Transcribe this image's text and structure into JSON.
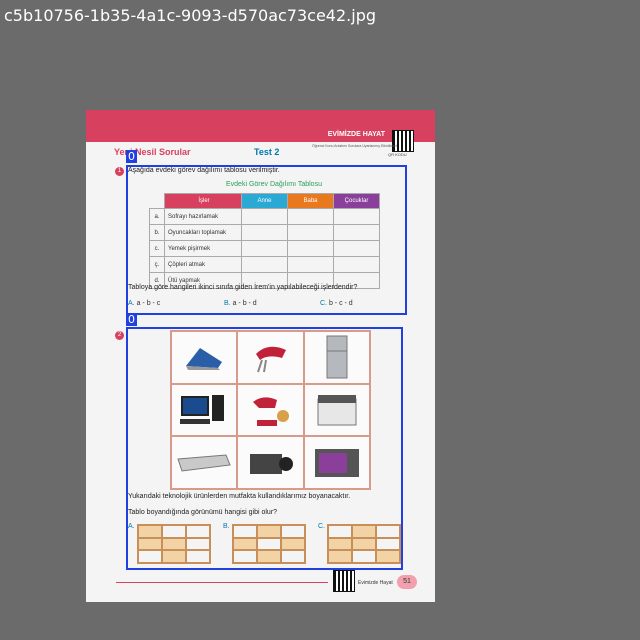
{
  "filename": "c5b10756-1b35-4a1c-9093-d570ac73ce42.jpg",
  "header": {
    "unit_title": "EVİMİZDE HAYAT",
    "section_title": "Yeni Nesil Sorular",
    "test_title": "Test 2",
    "qr_caption": "QR KODU",
    "note": "Öğrenci Konu Anlatımı Sorulara Uyarlanmış Etkinlikleri"
  },
  "q1": {
    "number": "1",
    "intro": "Aşağıda evdeki görev dağılımı tablosu verilmiştir.",
    "table_title": "Evdeki Görev Dağılımı Tablosu",
    "headers": [
      "İşler",
      "Anne",
      "Baba",
      "Çocuklar"
    ],
    "header_colors": [
      "#d8405f",
      "#29a9d4",
      "#e8791f",
      "#8a3f9a"
    ],
    "rows": [
      {
        "letter": "a.",
        "task": "Sofrayı hazırlamak"
      },
      {
        "letter": "b.",
        "task": "Oyuncakları toplamak"
      },
      {
        "letter": "c.",
        "task": "Yemek pişirmek"
      },
      {
        "letter": "ç.",
        "task": "Çöpleri atmak"
      },
      {
        "letter": "d.",
        "task": "Ütü yapmak"
      }
    ],
    "question": "Tabloya göre hangileri ikinci sınıfa giden İrem'in yapılabileceği işlerdendir?",
    "options": [
      {
        "label": "A.",
        "text": "a - b - c"
      },
      {
        "label": "B.",
        "text": "a - b - d"
      },
      {
        "label": "C.",
        "text": "b - c - d"
      }
    ]
  },
  "q2": {
    "number": "2",
    "appliances": [
      "iron-icon",
      "mixer-icon",
      "refrigerator-icon",
      "computer-icon",
      "stand-mixer-icon",
      "printer-icon",
      "range-hood-icon",
      "camcorder-icon",
      "oven-icon"
    ],
    "text1": "Yukarıdaki teknolojik ürünlerden mutfakta kullandıklarımız boyanacaktır.",
    "text2": "Tablo boyandığında görünümü hangisi gibi olur?",
    "options": [
      {
        "label": "A.",
        "filled": [
          1,
          0,
          0,
          1,
          1,
          0,
          0,
          1,
          0
        ]
      },
      {
        "label": "B.",
        "filled": [
          0,
          1,
          0,
          1,
          0,
          1,
          0,
          1,
          0
        ]
      },
      {
        "label": "C.",
        "filled": [
          0,
          1,
          0,
          1,
          1,
          0,
          1,
          0,
          1
        ]
      }
    ]
  },
  "footer": {
    "text": "Evimizde Hayat",
    "page": "51"
  },
  "detections": [
    {
      "label": "0"
    },
    {
      "label": "0"
    }
  ],
  "colors": {
    "accent": "#d8405f",
    "detection": "#2040e0",
    "option": "#0077aa"
  }
}
